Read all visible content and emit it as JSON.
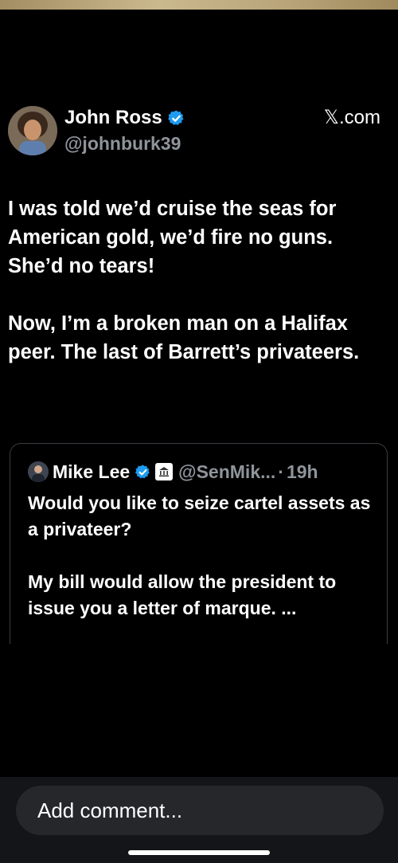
{
  "post": {
    "author_name": "John Ross",
    "author_handle": "@johnburk39",
    "source": "𝕏.com",
    "text": "I was told we’d cruise the seas for American gold, we’d fire no guns. She’d no tears!\n\nNow, I’m a broken man on a Halifax peer. The last of Barrett’s privateers."
  },
  "quote": {
    "author_name": "Mike Lee",
    "author_handle": "@SenMik...",
    "separator": "·",
    "time": "19h",
    "text": "Would you like to seize cartel assets as a privateer?\n\nMy bill would allow the president to issue you a letter of marque. ..."
  },
  "comment": {
    "placeholder": "Add comment..."
  },
  "icons": {
    "verified": "verified-badge-icon",
    "government": "government-building-icon"
  },
  "colors": {
    "background": "#000000",
    "verified": "#1d9bf0",
    "muted": "#8e949b",
    "bottom_bar": "#141518",
    "input": "#26272b"
  }
}
